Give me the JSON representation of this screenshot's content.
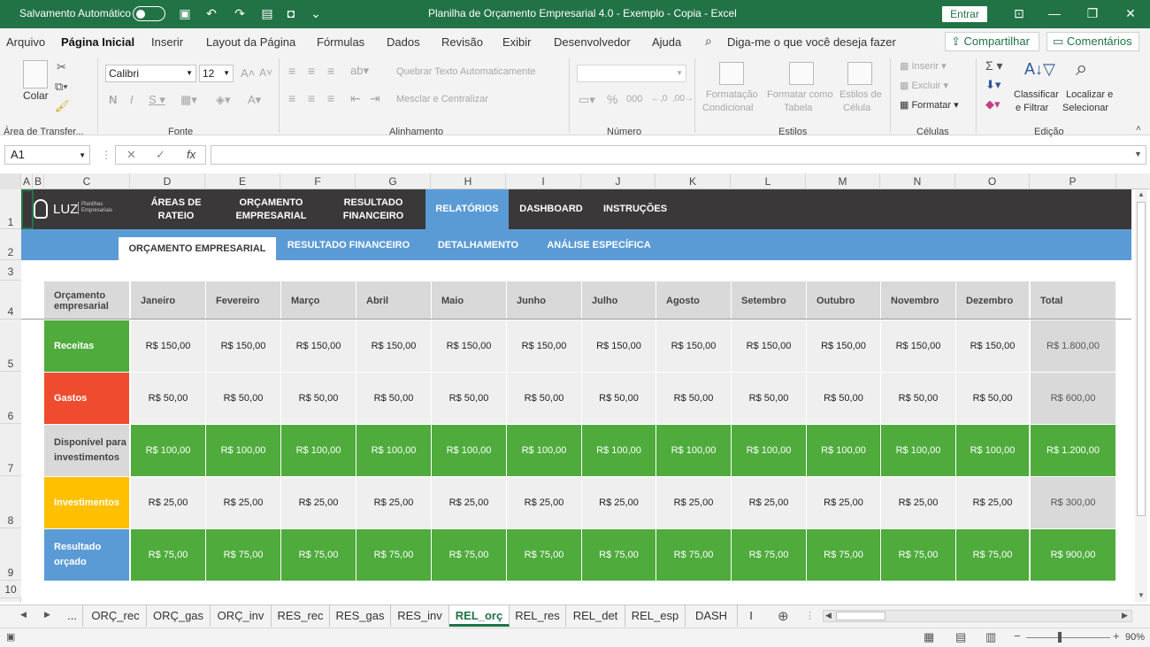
{
  "titlebar": {
    "autosave_label": "Salvamento Automático",
    "title": "Planilha de Orçamento Empresarial 4.0 - Exemplo - Copia  -  Excel",
    "signin": "Entrar"
  },
  "menu": {
    "items": [
      "Arquivo",
      "Página Inicial",
      "Inserir",
      "Layout da Página",
      "Fórmulas",
      "Dados",
      "Revisão",
      "Exibir",
      "Desenvolvedor",
      "Ajuda"
    ],
    "tell_me": "Diga-me o que você deseja fazer",
    "share": "Compartilhar",
    "comments": "Comentários"
  },
  "ribbon": {
    "paste": "Colar",
    "clipboard_group": "Área de Transfer...",
    "font_name": "Calibri",
    "font_size": "12",
    "font_group": "Fonte",
    "wrap_text": "Quebrar Texto Automaticamente",
    "merge_center": "Mesclar e Centralizar",
    "alignment_group": "Alinhamento",
    "number_group": "Número",
    "cond_format_1": "Formatação",
    "cond_format_2": "Condicional",
    "format_table_1": "Formatar como",
    "format_table_2": "Tabela",
    "cell_styles_1": "Estilos de",
    "cell_styles_2": "Célula",
    "styles_group": "Estilos",
    "insert": "Inserir",
    "delete": "Excluir",
    "format": "Formatar",
    "cells_group": "Células",
    "sort_1": "Classificar",
    "sort_2": "e Filtrar",
    "find_1": "Localizar e",
    "find_2": "Selecionar",
    "editing_group": "Edição"
  },
  "formula_bar": {
    "name_box": "A1",
    "fx": "fx",
    "value": ""
  },
  "columns": [
    "A",
    "B",
    "C",
    "D",
    "E",
    "F",
    "G",
    "H",
    "I",
    "J",
    "K",
    "L",
    "M",
    "N",
    "O",
    "P"
  ],
  "rows": [
    "1",
    "2",
    "3",
    "4",
    "5",
    "6",
    "7",
    "8",
    "9",
    "10"
  ],
  "nav": {
    "logo": "LUZ",
    "logo_sub": "Planilhas Empresariais",
    "items": [
      "ÁREAS DE\nRATEIO",
      "ORÇAMENTO\nEMPRESARIAL",
      "RESULTADO\nFINANCEIRO",
      "RELATÓRIOS",
      "DASHBOARD",
      "INSTRUÇÕES"
    ]
  },
  "subnav": [
    "ORÇAMENTO EMPRESARIAL",
    "RESULTADO FINANCEIRO",
    "DETALHAMENTO",
    "ANÁLISE ESPECÍFICA"
  ],
  "table": {
    "corner": "Orçamento empresarial",
    "months": [
      "Janeiro",
      "Fevereiro",
      "Março",
      "Abril",
      "Maio",
      "Junho",
      "Julho",
      "Agosto",
      "Setembro",
      "Outubro",
      "Novembro",
      "Dezembro"
    ],
    "total_label": "Total",
    "rows": [
      {
        "label": "Receitas",
        "color": "#4eab3c",
        "value": "R$ 150,00",
        "total": "R$ 1.800,00"
      },
      {
        "label": "Gastos",
        "color": "#ef4b2f",
        "value": "R$ 50,00",
        "total": "R$ 600,00"
      },
      {
        "label": "Disponível para investimentos",
        "color": "#d9d9d9",
        "value": "R$ 100,00",
        "total": "R$ 1.200,00"
      },
      {
        "label": "Investimentos",
        "color": "#ffc000",
        "value": "R$ 25,00",
        "total": "R$ 300,00"
      },
      {
        "label": "Resultado orçado",
        "color": "#5b9bd5",
        "value": "R$ 75,00",
        "total": "R$ 900,00"
      }
    ]
  },
  "sheets": [
    "...",
    "ORÇ_rec",
    "ORÇ_gas",
    "ORÇ_inv",
    "RES_rec",
    "RES_gas",
    "RES_inv",
    "REL_orç",
    "REL_res",
    "REL_det",
    "REL_esp",
    "DASH",
    "I"
  ],
  "active_sheet": "REL_orç",
  "status": {
    "zoom": "90%"
  }
}
